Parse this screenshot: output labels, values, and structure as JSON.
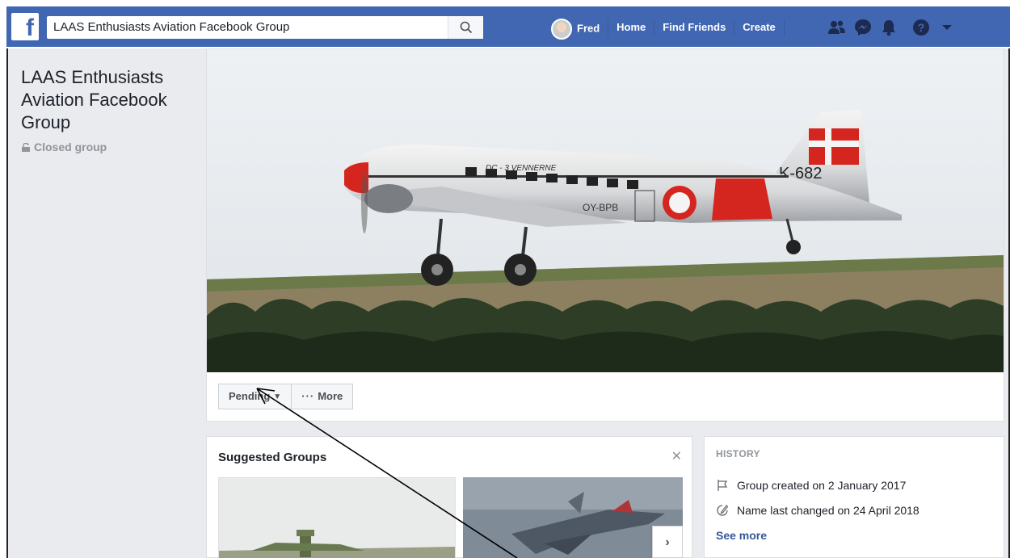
{
  "header": {
    "search_value": "LAAS Enthusiasts Aviation  Facebook Group",
    "nav": {
      "profile_name": "Fred",
      "home": "Home",
      "find_friends": "Find Friends",
      "create": "Create"
    },
    "brand_color": "#4267b2",
    "icons": [
      "friend-requests-icon",
      "messenger-icon",
      "notifications-icon",
      "help-icon",
      "account-menu-icon"
    ]
  },
  "group": {
    "title": "LAAS Enthusiasts Aviation Facebook Group",
    "privacy": "Closed group"
  },
  "cover": {
    "aircraft_titles": "DC - 3 VENNERNE",
    "registration": "OY-BPB",
    "tail_code": "K-682"
  },
  "actions": {
    "pending": "Pending",
    "more": "More"
  },
  "suggested": {
    "title": "Suggested Groups"
  },
  "history": {
    "heading": "HISTORY",
    "created": "Group created on 2 January 2017",
    "renamed": "Name last changed on 24 April 2018",
    "see_more": "See more"
  }
}
